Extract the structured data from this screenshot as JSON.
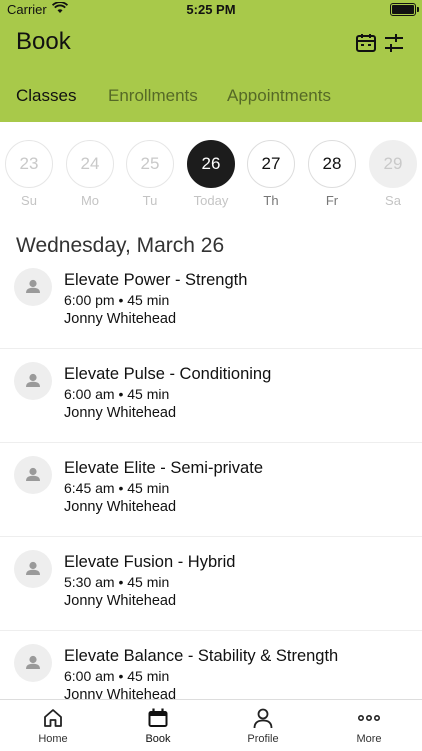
{
  "status_bar": {
    "carrier": "Carrier",
    "time": "5:25 PM"
  },
  "header": {
    "title": "Book",
    "icons": [
      "calendar-icon",
      "filter-sliders-icon"
    ]
  },
  "tabs": [
    {
      "label": "Classes",
      "active": true
    },
    {
      "label": "Enrollments",
      "active": false
    },
    {
      "label": "Appointments",
      "active": false
    }
  ],
  "date_strip": [
    {
      "num": "23",
      "label": "Su",
      "state": "past"
    },
    {
      "num": "24",
      "label": "Mo",
      "state": "past"
    },
    {
      "num": "25",
      "label": "Tu",
      "state": "past"
    },
    {
      "num": "26",
      "label": "Today",
      "state": "selected"
    },
    {
      "num": "27",
      "label": "Th",
      "state": "future"
    },
    {
      "num": "28",
      "label": "Fr",
      "state": "future"
    },
    {
      "num": "29",
      "label": "Sa",
      "state": "disabled"
    }
  ],
  "date_heading": "Wednesday, March 26",
  "classes": [
    {
      "name": "Elevate Power - Strength",
      "meta": "6:00 pm • 45 min",
      "instructor": "Jonny Whitehead"
    },
    {
      "name": "Elevate Pulse - Conditioning",
      "meta": "6:00 am • 45 min",
      "instructor": "Jonny Whitehead"
    },
    {
      "name": "Elevate Elite - Semi-private",
      "meta": "6:45 am • 45 min",
      "instructor": "Jonny Whitehead"
    },
    {
      "name": "Elevate Fusion - Hybrid",
      "meta": "5:30 am • 45 min",
      "instructor": "Jonny Whitehead"
    },
    {
      "name": "Elevate Balance - Stability & Strength",
      "meta": "6:00 am • 45 min",
      "instructor": "Jonny Whitehead"
    }
  ],
  "tab_bar": [
    {
      "label": "Home",
      "icon": "home-icon"
    },
    {
      "label": "Book",
      "icon": "calendar-icon",
      "active": true
    },
    {
      "label": "Profile",
      "icon": "person-icon"
    },
    {
      "label": "More",
      "icon": "more-dots-icon"
    }
  ],
  "colors": {
    "header_bg": "#a8c94a",
    "selected_day": "#1c1c1c"
  }
}
